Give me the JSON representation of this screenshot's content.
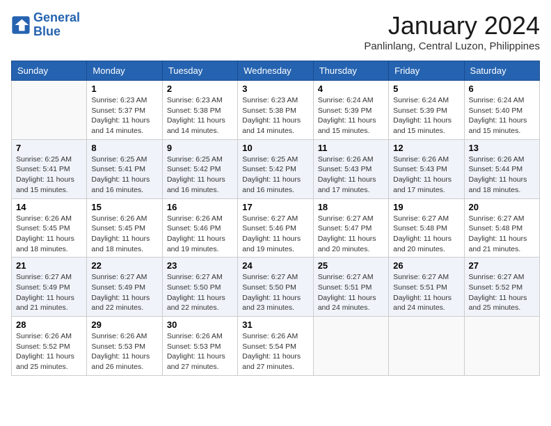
{
  "header": {
    "logo_line1": "General",
    "logo_line2": "Blue",
    "month_title": "January 2024",
    "location": "Panlinlang, Central Luzon, Philippines"
  },
  "days_of_week": [
    "Sunday",
    "Monday",
    "Tuesday",
    "Wednesday",
    "Thursday",
    "Friday",
    "Saturday"
  ],
  "weeks": [
    [
      {
        "day": "",
        "empty": true
      },
      {
        "day": "1",
        "sunrise": "Sunrise: 6:23 AM",
        "sunset": "Sunset: 5:37 PM",
        "daylight": "Daylight: 11 hours and 14 minutes."
      },
      {
        "day": "2",
        "sunrise": "Sunrise: 6:23 AM",
        "sunset": "Sunset: 5:38 PM",
        "daylight": "Daylight: 11 hours and 14 minutes."
      },
      {
        "day": "3",
        "sunrise": "Sunrise: 6:23 AM",
        "sunset": "Sunset: 5:38 PM",
        "daylight": "Daylight: 11 hours and 14 minutes."
      },
      {
        "day": "4",
        "sunrise": "Sunrise: 6:24 AM",
        "sunset": "Sunset: 5:39 PM",
        "daylight": "Daylight: 11 hours and 15 minutes."
      },
      {
        "day": "5",
        "sunrise": "Sunrise: 6:24 AM",
        "sunset": "Sunset: 5:39 PM",
        "daylight": "Daylight: 11 hours and 15 minutes."
      },
      {
        "day": "6",
        "sunrise": "Sunrise: 6:24 AM",
        "sunset": "Sunset: 5:40 PM",
        "daylight": "Daylight: 11 hours and 15 minutes."
      }
    ],
    [
      {
        "day": "7",
        "sunrise": "Sunrise: 6:25 AM",
        "sunset": "Sunset: 5:41 PM",
        "daylight": "Daylight: 11 hours and 15 minutes."
      },
      {
        "day": "8",
        "sunrise": "Sunrise: 6:25 AM",
        "sunset": "Sunset: 5:41 PM",
        "daylight": "Daylight: 11 hours and 16 minutes."
      },
      {
        "day": "9",
        "sunrise": "Sunrise: 6:25 AM",
        "sunset": "Sunset: 5:42 PM",
        "daylight": "Daylight: 11 hours and 16 minutes."
      },
      {
        "day": "10",
        "sunrise": "Sunrise: 6:25 AM",
        "sunset": "Sunset: 5:42 PM",
        "daylight": "Daylight: 11 hours and 16 minutes."
      },
      {
        "day": "11",
        "sunrise": "Sunrise: 6:26 AM",
        "sunset": "Sunset: 5:43 PM",
        "daylight": "Daylight: 11 hours and 17 minutes."
      },
      {
        "day": "12",
        "sunrise": "Sunrise: 6:26 AM",
        "sunset": "Sunset: 5:43 PM",
        "daylight": "Daylight: 11 hours and 17 minutes."
      },
      {
        "day": "13",
        "sunrise": "Sunrise: 6:26 AM",
        "sunset": "Sunset: 5:44 PM",
        "daylight": "Daylight: 11 hours and 18 minutes."
      }
    ],
    [
      {
        "day": "14",
        "sunrise": "Sunrise: 6:26 AM",
        "sunset": "Sunset: 5:45 PM",
        "daylight": "Daylight: 11 hours and 18 minutes."
      },
      {
        "day": "15",
        "sunrise": "Sunrise: 6:26 AM",
        "sunset": "Sunset: 5:45 PM",
        "daylight": "Daylight: 11 hours and 18 minutes."
      },
      {
        "day": "16",
        "sunrise": "Sunrise: 6:26 AM",
        "sunset": "Sunset: 5:46 PM",
        "daylight": "Daylight: 11 hours and 19 minutes."
      },
      {
        "day": "17",
        "sunrise": "Sunrise: 6:27 AM",
        "sunset": "Sunset: 5:46 PM",
        "daylight": "Daylight: 11 hours and 19 minutes."
      },
      {
        "day": "18",
        "sunrise": "Sunrise: 6:27 AM",
        "sunset": "Sunset: 5:47 PM",
        "daylight": "Daylight: 11 hours and 20 minutes."
      },
      {
        "day": "19",
        "sunrise": "Sunrise: 6:27 AM",
        "sunset": "Sunset: 5:48 PM",
        "daylight": "Daylight: 11 hours and 20 minutes."
      },
      {
        "day": "20",
        "sunrise": "Sunrise: 6:27 AM",
        "sunset": "Sunset: 5:48 PM",
        "daylight": "Daylight: 11 hours and 21 minutes."
      }
    ],
    [
      {
        "day": "21",
        "sunrise": "Sunrise: 6:27 AM",
        "sunset": "Sunset: 5:49 PM",
        "daylight": "Daylight: 11 hours and 21 minutes."
      },
      {
        "day": "22",
        "sunrise": "Sunrise: 6:27 AM",
        "sunset": "Sunset: 5:49 PM",
        "daylight": "Daylight: 11 hours and 22 minutes."
      },
      {
        "day": "23",
        "sunrise": "Sunrise: 6:27 AM",
        "sunset": "Sunset: 5:50 PM",
        "daylight": "Daylight: 11 hours and 22 minutes."
      },
      {
        "day": "24",
        "sunrise": "Sunrise: 6:27 AM",
        "sunset": "Sunset: 5:50 PM",
        "daylight": "Daylight: 11 hours and 23 minutes."
      },
      {
        "day": "25",
        "sunrise": "Sunrise: 6:27 AM",
        "sunset": "Sunset: 5:51 PM",
        "daylight": "Daylight: 11 hours and 24 minutes."
      },
      {
        "day": "26",
        "sunrise": "Sunrise: 6:27 AM",
        "sunset": "Sunset: 5:51 PM",
        "daylight": "Daylight: 11 hours and 24 minutes."
      },
      {
        "day": "27",
        "sunrise": "Sunrise: 6:27 AM",
        "sunset": "Sunset: 5:52 PM",
        "daylight": "Daylight: 11 hours and 25 minutes."
      }
    ],
    [
      {
        "day": "28",
        "sunrise": "Sunrise: 6:26 AM",
        "sunset": "Sunset: 5:52 PM",
        "daylight": "Daylight: 11 hours and 25 minutes."
      },
      {
        "day": "29",
        "sunrise": "Sunrise: 6:26 AM",
        "sunset": "Sunset: 5:53 PM",
        "daylight": "Daylight: 11 hours and 26 minutes."
      },
      {
        "day": "30",
        "sunrise": "Sunrise: 6:26 AM",
        "sunset": "Sunset: 5:53 PM",
        "daylight": "Daylight: 11 hours and 27 minutes."
      },
      {
        "day": "31",
        "sunrise": "Sunrise: 6:26 AM",
        "sunset": "Sunset: 5:54 PM",
        "daylight": "Daylight: 11 hours and 27 minutes."
      },
      {
        "day": "",
        "empty": true
      },
      {
        "day": "",
        "empty": true
      },
      {
        "day": "",
        "empty": true
      }
    ]
  ]
}
